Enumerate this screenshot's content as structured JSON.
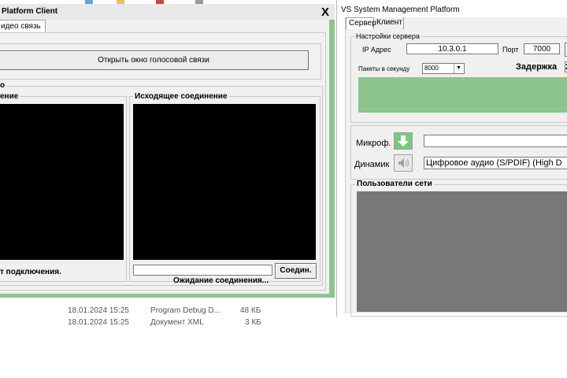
{
  "background": {
    "files": [
      {
        "date": "18.01.2024 15:25",
        "type": "Program Debug D...",
        "size": "48 КБ"
      },
      {
        "date": "18.01.2024 15:25",
        "type": "Документ XML",
        "size": "3 КБ"
      }
    ]
  },
  "client_window": {
    "title": "Platform Client",
    "close_label": "X",
    "tab_label": "идео связь",
    "open_voice_button": "Открыть окно голосовой связи",
    "video_group_label": "о",
    "incoming_label": "ение",
    "outgoing_label": "Исходящее соединение",
    "connect_input_value": "",
    "connect_button": "Соедин.",
    "left_status": "т подключения.",
    "right_status": "Ожидание соединения..."
  },
  "server_window": {
    "title": "VS System Management Platform",
    "tabs": [
      "Сервер",
      "Клиент"
    ],
    "server_settings_label": "Настройки сервера",
    "ip_label": "IP Адрес",
    "ip_value": "10.3.0.1",
    "port_label": "Порт",
    "port_value": "7000",
    "packets_label": "Пакеты в секунду",
    "packets_value": "8000",
    "delay_label": "Задержка",
    "delay_value": "2",
    "mic_label": "Микроф.",
    "mic_value": "",
    "speaker_label": "Динамик",
    "speaker_value": "Цифровое аудио (S/PDIF) (High D",
    "network_users_label": "Пользователи сети"
  },
  "colors": {
    "accent_green": "#8ec48e",
    "video_black": "#000000",
    "users_panel_gray": "#787878"
  }
}
